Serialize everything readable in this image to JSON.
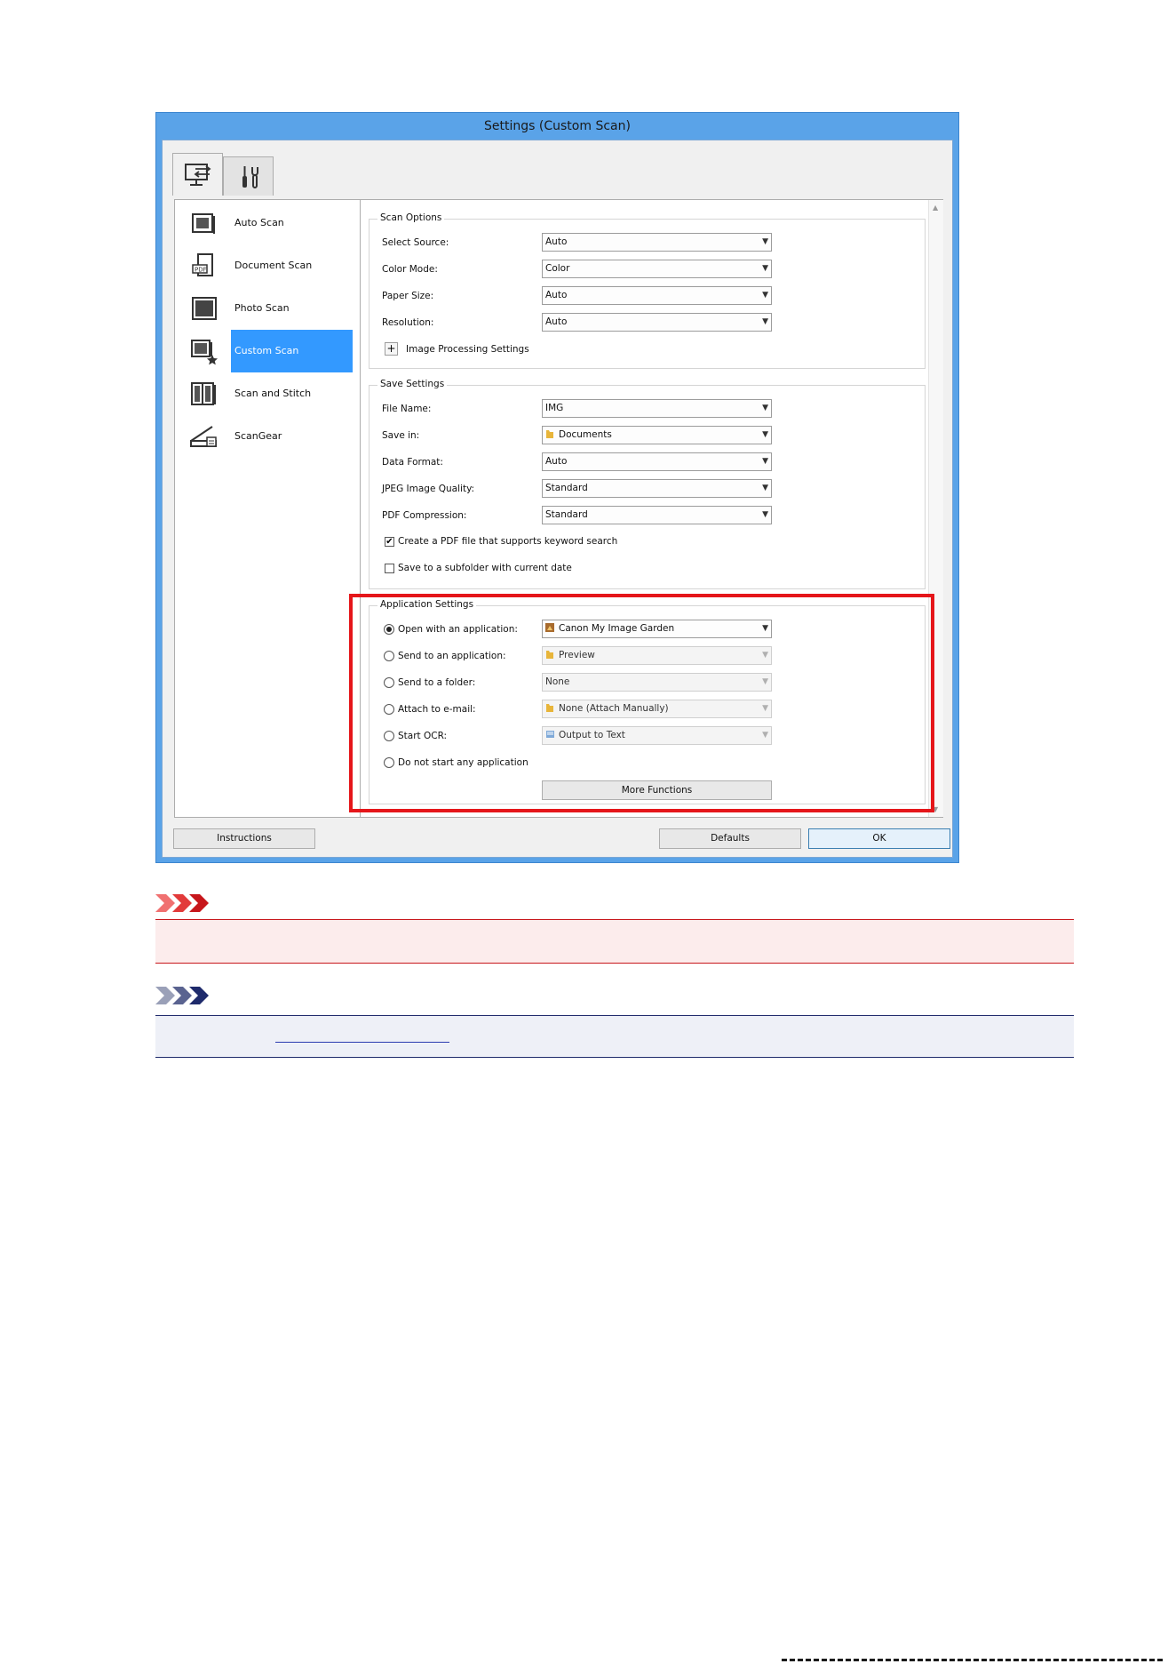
{
  "window": {
    "title": "Settings (Custom Scan)"
  },
  "tabs": [
    {
      "name": "scan-from-computer",
      "icon": "scan-to-pc-icon"
    },
    {
      "name": "general-settings",
      "icon": "tools-icon"
    }
  ],
  "sidebar": {
    "items": [
      {
        "label": "Auto Scan",
        "icon": "auto-scan-icon"
      },
      {
        "label": "Document Scan",
        "icon": "document-scan-icon"
      },
      {
        "label": "Photo Scan",
        "icon": "photo-scan-icon"
      },
      {
        "label": "Custom Scan",
        "icon": "custom-scan-icon",
        "selected": true
      },
      {
        "label": "Scan and Stitch",
        "icon": "scan-and-stitch-icon"
      },
      {
        "label": "ScanGear",
        "icon": "scangear-icon"
      }
    ]
  },
  "scan_options": {
    "title": "Scan Options",
    "select_source": {
      "label": "Select Source:",
      "value": "Auto"
    },
    "color_mode": {
      "label": "Color Mode:",
      "value": "Color"
    },
    "paper_size": {
      "label": "Paper Size:",
      "value": "Auto"
    },
    "resolution": {
      "label": "Resolution:",
      "value": "Auto"
    },
    "image_processing": {
      "label": "Image Processing Settings",
      "button": "+"
    }
  },
  "save_settings": {
    "title": "Save Settings",
    "file_name": {
      "label": "File Name:",
      "value": "IMG"
    },
    "save_in": {
      "label": "Save in:",
      "value": "Documents",
      "icon": "folder-icon"
    },
    "data_format": {
      "label": "Data Format:",
      "value": "Auto"
    },
    "jpeg_quality": {
      "label": "JPEG Image Quality:",
      "value": "Standard"
    },
    "pdf_compression": {
      "label": "PDF Compression:",
      "value": "Standard"
    },
    "keyword_search": {
      "label": "Create a PDF file that supports keyword search",
      "checked": true
    },
    "subfolder": {
      "label": "Save to a subfolder with current date",
      "checked": false
    }
  },
  "app_settings": {
    "title": "Application Settings",
    "open_with": {
      "label": "Open with an application:",
      "value": "Canon My Image Garden",
      "selected": true,
      "icon": "image-garden-icon"
    },
    "send_to_app": {
      "label": "Send to an application:",
      "value": "Preview",
      "icon": "folder-icon"
    },
    "send_to_folder": {
      "label": "Send to a folder:",
      "value": "None"
    },
    "attach_email": {
      "label": "Attach to e-mail:",
      "value": "None (Attach Manually)",
      "icon": "folder-icon"
    },
    "start_ocr": {
      "label": "Start OCR:",
      "value": "Output to Text",
      "icon": "ocr-icon"
    },
    "no_app": {
      "label": "Do not start any application"
    },
    "more_functions": "More Functions"
  },
  "footer": {
    "instructions": "Instructions",
    "defaults": "Defaults",
    "ok": "OK"
  },
  "colors": {
    "accent": "#3399ff",
    "highlight": "#e5161a",
    "important": "#c7161b",
    "note": "#1e2a6b"
  }
}
